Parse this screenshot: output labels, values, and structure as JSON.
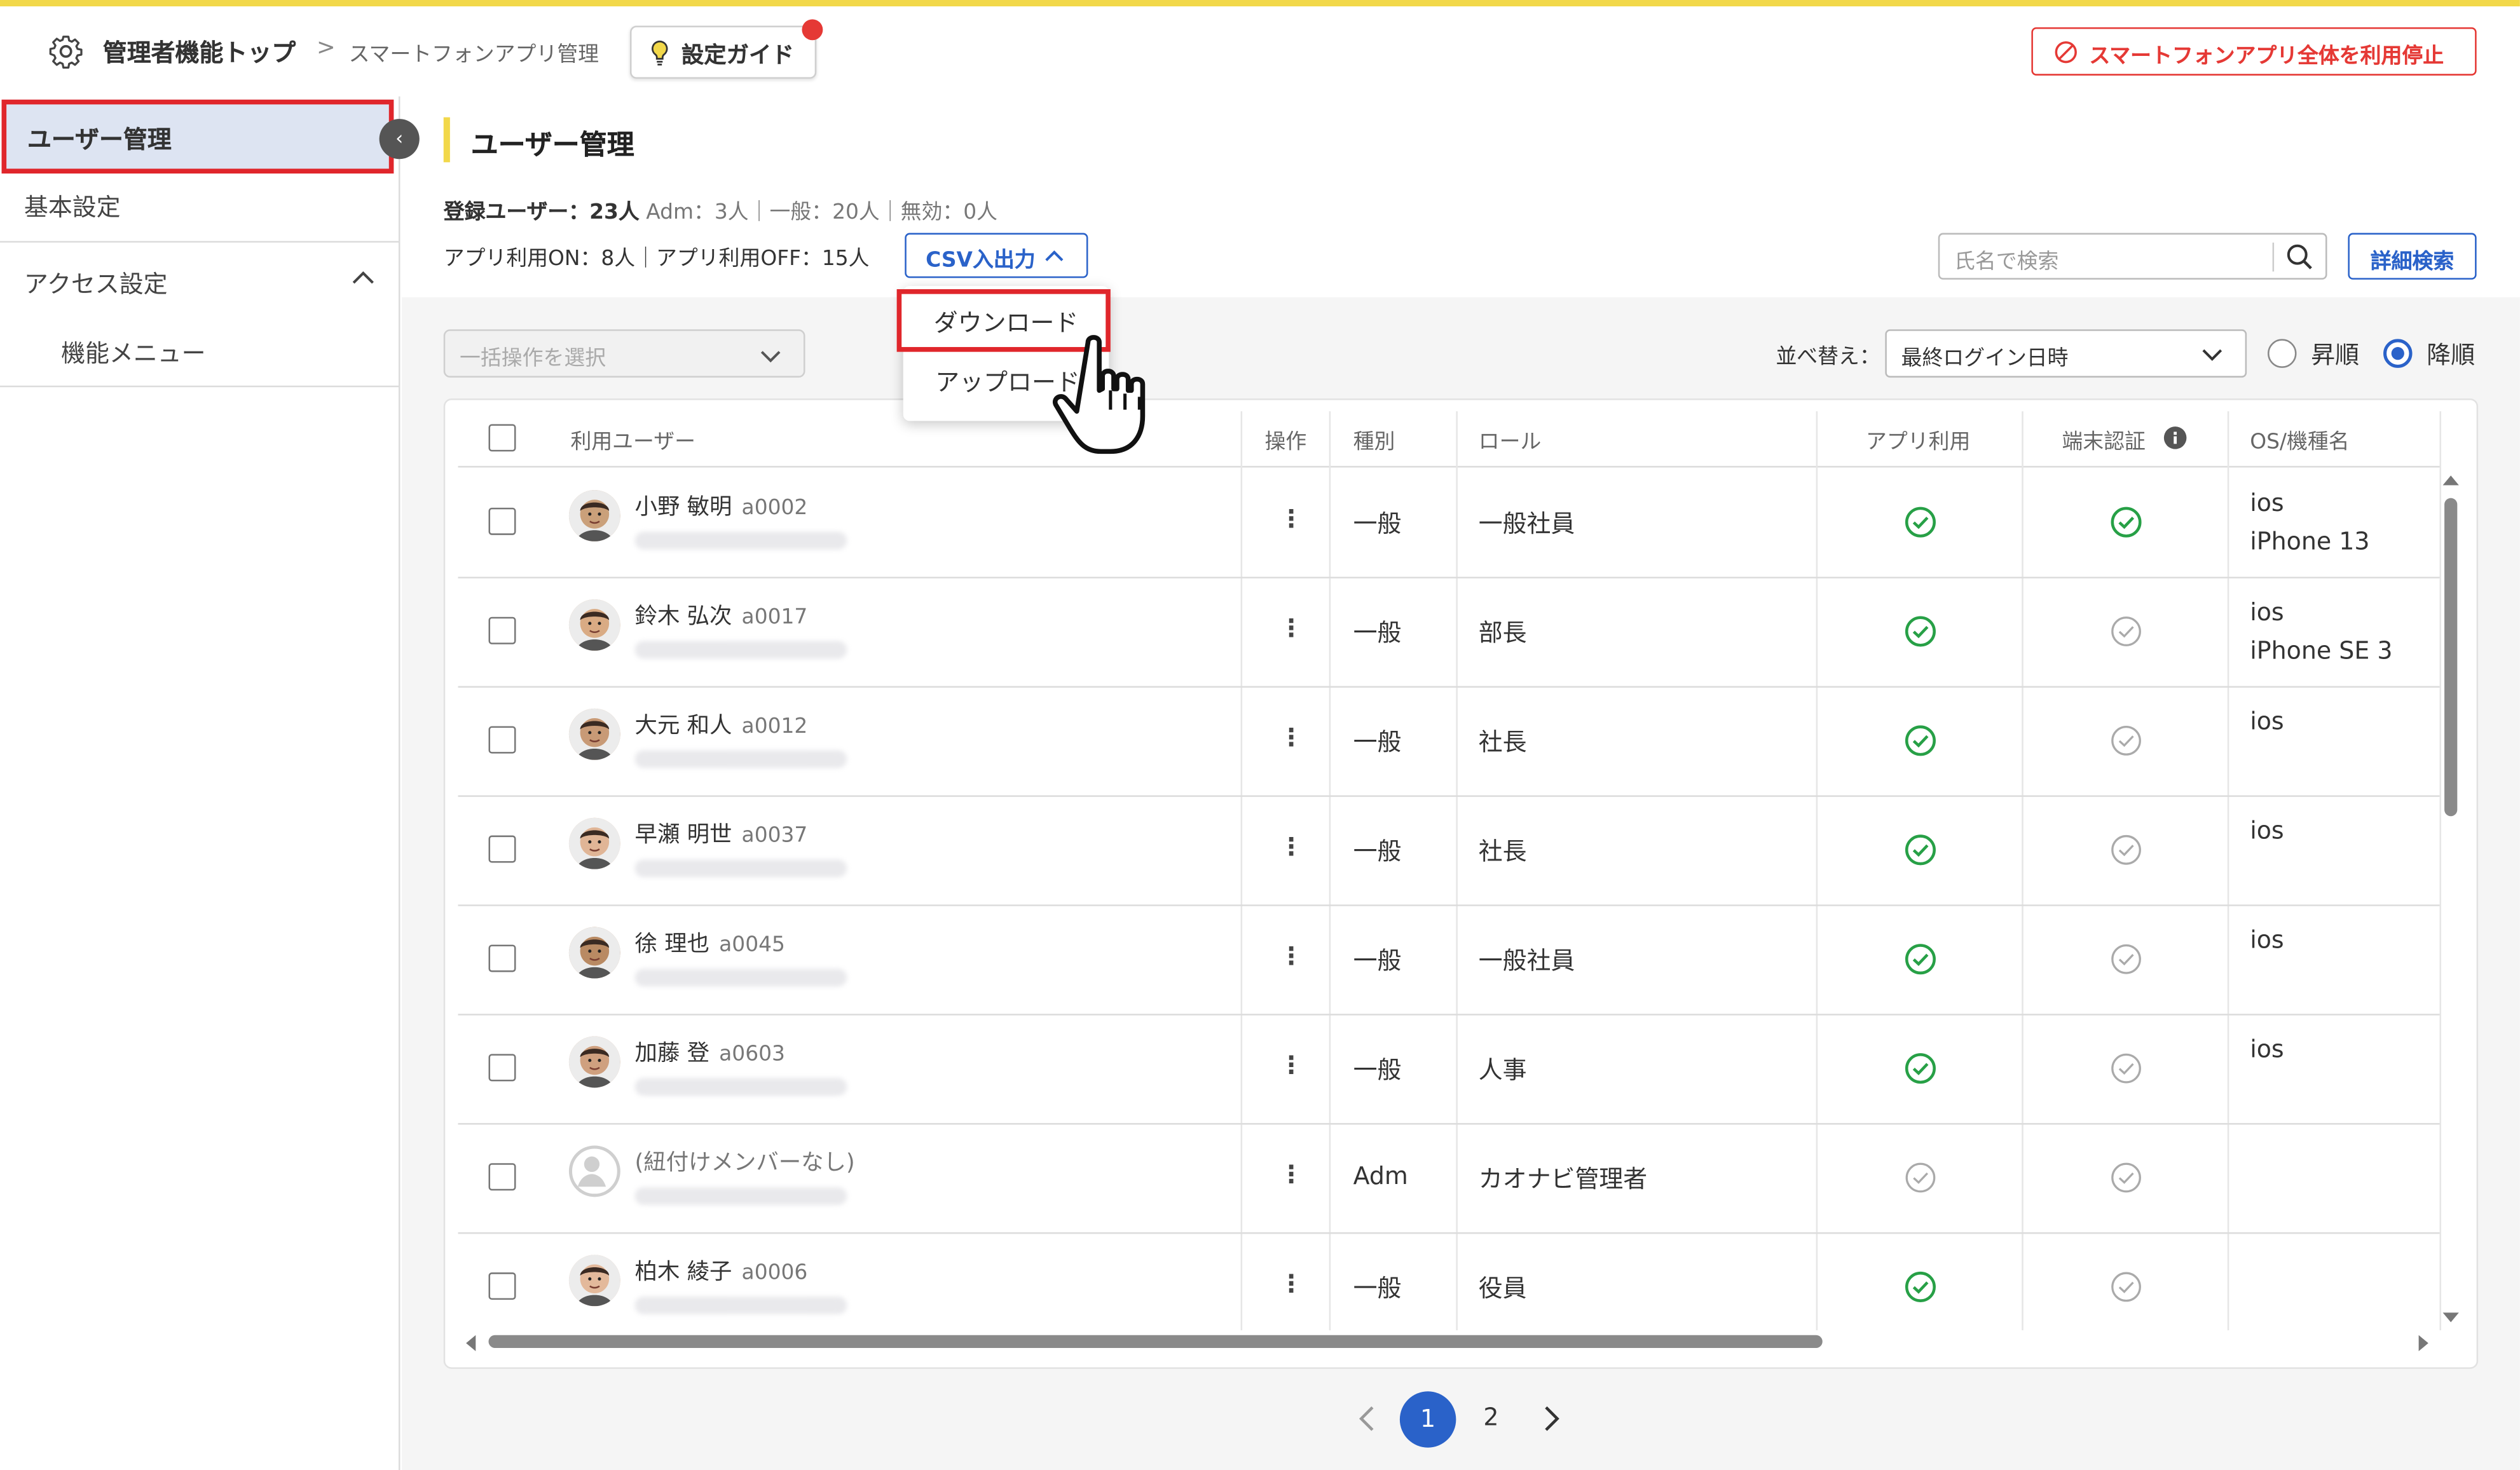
{
  "colors": {
    "accent": "#2a62c9",
    "danger": "#e53935",
    "highlight": "#e0262b",
    "yellow": "#f2d84a",
    "ok": "#27a046",
    "off": "#aaaaaa"
  },
  "header": {
    "home_label": "管理者機能トップ",
    "separator": ">",
    "current_label": "スマートフォンアプリ管理",
    "guide_label": "設定ガイド",
    "stop_label": "スマートフォンアプリ全体を利用停止"
  },
  "sidebar": {
    "items": [
      {
        "label": "ユーザー管理"
      },
      {
        "label": "基本設定"
      },
      {
        "label": "アクセス設定"
      },
      {
        "label": "機能メニュー"
      }
    ],
    "collapse_glyph": "‹"
  },
  "main": {
    "title": "ユーザー管理",
    "stats_line1_a": "登録ユーザー：23人",
    "stats_line1_b": "Adm：3人｜一般：20人｜無効：0人",
    "stats_line2": "アプリ利用ON：8人｜アプリ利用OFF：15人",
    "csv_label": "CSV入出力",
    "search_placeholder": "氏名で検索",
    "advanced_search_label": "詳細検索",
    "bulk_placeholder": "一括操作を選択",
    "sort_label": "並べ替え：",
    "sort_value": "最終ログイン日時",
    "order_asc": "昇順",
    "order_desc": "降順",
    "order_selected": "降順"
  },
  "csv_menu": {
    "download": "ダウンロード",
    "upload": "アップロード"
  },
  "table": {
    "headers": [
      "利用ユーザー",
      "操作",
      "種別",
      "ロール",
      "アプリ利用",
      "端末認証",
      "OS/機種名"
    ],
    "rows": [
      {
        "name": "小野 敏明",
        "id": "a0002",
        "op": "⋮",
        "type": "一般",
        "role": "一般社員",
        "app": true,
        "auth": true,
        "os1": "ios",
        "os2": "iPhone 13"
      },
      {
        "name": "鈴木 弘次",
        "id": "a0017",
        "op": "⋮",
        "type": "一般",
        "role": "部長",
        "app": true,
        "auth": false,
        "os1": "ios",
        "os2": "iPhone SE 3"
      },
      {
        "name": "大元 和人",
        "id": "a0012",
        "op": "⋮",
        "type": "一般",
        "role": "社長",
        "app": true,
        "auth": false,
        "os1": "ios",
        "os2": ""
      },
      {
        "name": "早瀬 明世",
        "id": "a0037",
        "op": "⋮",
        "type": "一般",
        "role": "社長",
        "app": true,
        "auth": false,
        "os1": "ios",
        "os2": ""
      },
      {
        "name": "徐 理也",
        "id": "a0045",
        "op": "⋮",
        "type": "一般",
        "role": "一般社員",
        "app": true,
        "auth": false,
        "os1": "ios",
        "os2": ""
      },
      {
        "name": "加藤 登",
        "id": "a0603",
        "op": "⋮",
        "type": "一般",
        "role": "人事",
        "app": true,
        "auth": false,
        "os1": "ios",
        "os2": ""
      },
      {
        "name": "(紐付けメンバーなし)",
        "id": "",
        "op": "⋮",
        "type": "Adm",
        "role": "カオナビ管理者",
        "app": false,
        "auth": false,
        "os1": "",
        "os2": ""
      },
      {
        "name": "柏木 綾子",
        "id": "a0006",
        "op": "⋮",
        "type": "一般",
        "role": "役員",
        "app": true,
        "auth": false,
        "os1": "",
        "os2": ""
      }
    ]
  },
  "pagination": {
    "current": "1",
    "next_page": "2"
  }
}
